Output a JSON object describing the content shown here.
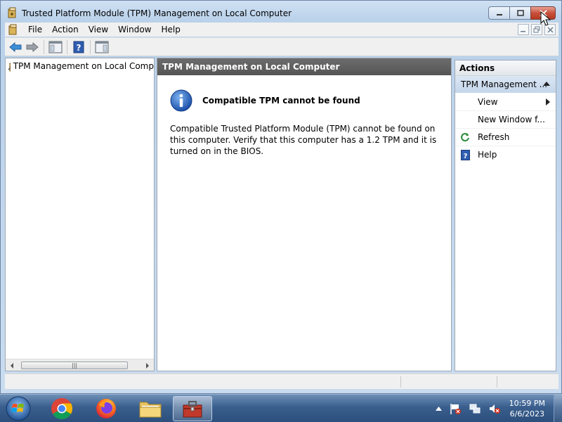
{
  "window": {
    "title": "Trusted Platform Module (TPM) Management on Local Computer"
  },
  "menu": {
    "items": [
      "File",
      "Action",
      "View",
      "Window",
      "Help"
    ]
  },
  "tree": {
    "root_label": "TPM Management on Local Comp"
  },
  "center": {
    "header": "TPM Management on Local Computer",
    "info_title": "Compatible TPM cannot be found",
    "info_body": "Compatible Trusted Platform Module (TPM) cannot be found on this computer. Verify that this computer has a 1.2 TPM and it is turned on in the BIOS."
  },
  "actions": {
    "header": "Actions",
    "group_label": "TPM Management ...",
    "items": [
      {
        "label": "View",
        "icon": "none",
        "submenu": true
      },
      {
        "label": "New Window f...",
        "icon": "none",
        "submenu": false
      },
      {
        "label": "Refresh",
        "icon": "refresh-icon",
        "submenu": false
      },
      {
        "label": "Help",
        "icon": "help-icon",
        "submenu": false
      }
    ]
  },
  "taskbar": {
    "apps": [
      "chrome",
      "firefox",
      "file-explorer",
      "tpm-management"
    ],
    "clock_time": "10:59 PM",
    "clock_date": "6/6/2023"
  },
  "colors": {
    "accent": "#2c5fa8",
    "close_red": "#c8503c",
    "header_gray": "#5e5e5e"
  }
}
